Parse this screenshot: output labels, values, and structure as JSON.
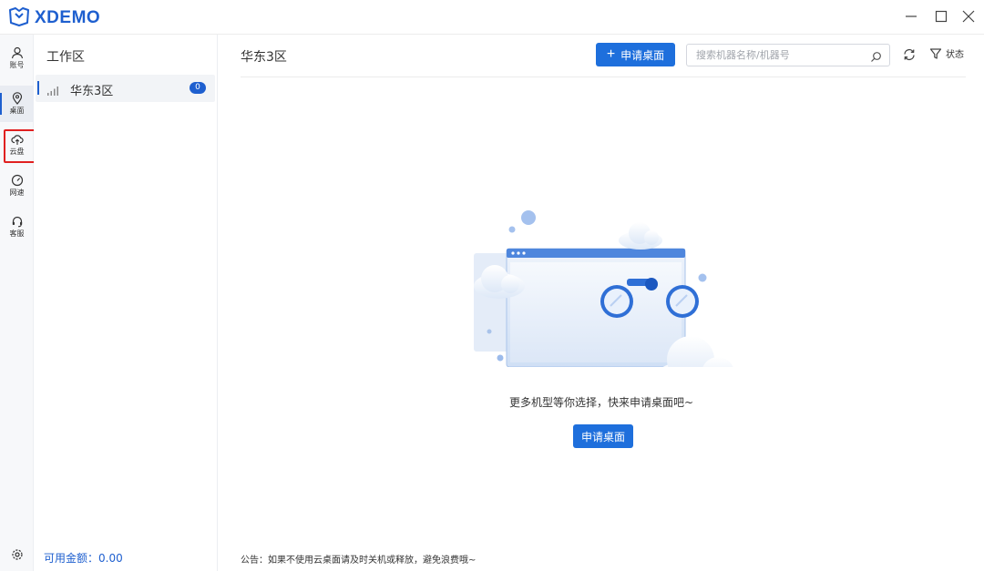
{
  "app": {
    "name": "XDEMO"
  },
  "rail": {
    "items": [
      {
        "key": "account",
        "label": "账号",
        "icon": "user-icon"
      },
      {
        "key": "desktop",
        "label": "桌面",
        "icon": "location-pin-icon"
      },
      {
        "key": "cloud",
        "label": "云盘",
        "icon": "cloud-upload-icon"
      },
      {
        "key": "speed",
        "label": "网速",
        "icon": "speedometer-icon"
      },
      {
        "key": "service",
        "label": "客服",
        "icon": "headset-icon"
      }
    ]
  },
  "workspace": {
    "title": "工作区",
    "regions": [
      {
        "name": "华东3区",
        "count": "0"
      }
    ],
    "balance": "可用金额：0.00"
  },
  "main": {
    "title": "华东3区",
    "apply_button": "申请桌面",
    "search_placeholder": "搜索机器名称/机器号",
    "status_label": "状态",
    "empty_text": "更多机型等你选择，快来申请桌面吧~",
    "empty_button": "申请桌面",
    "notice": "公告：如果不使用云桌面请及时关机或释放，避免浪费哦~"
  },
  "colors": {
    "accent": "#1e6fdc",
    "highlight": "#e02020"
  }
}
